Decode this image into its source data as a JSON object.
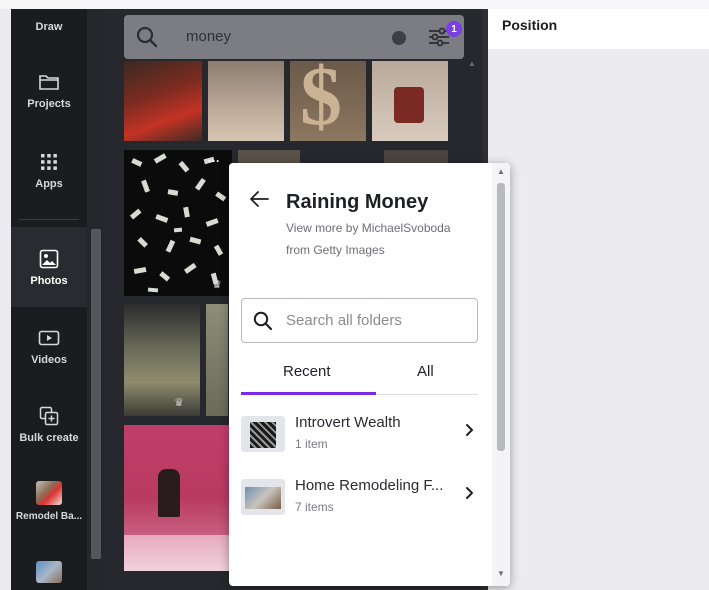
{
  "sidebar": {
    "items": [
      {
        "label": "Draw",
        "icon": "draw-icon"
      },
      {
        "label": "Projects",
        "icon": "folder-icon"
      },
      {
        "label": "Apps",
        "icon": "apps-grid-icon"
      },
      {
        "label": "Photos",
        "icon": "photos-icon",
        "active": true
      },
      {
        "label": "Videos",
        "icon": "video-play-icon"
      },
      {
        "label": "Bulk create",
        "icon": "bulk-create-icon"
      },
      {
        "label": "Remodel Ba...",
        "icon": "remodel-app-thumbnail"
      },
      {
        "label": "",
        "icon": "app-thumbnail"
      }
    ]
  },
  "search": {
    "query": "money",
    "filter_badge": "1"
  },
  "right_panel": {
    "title": "Position"
  },
  "popup": {
    "title": "Raining Money",
    "subtitle": "View more by MichaelSvoboda from Getty Images",
    "search_placeholder": "Search all folders",
    "tabs": [
      {
        "label": "Recent",
        "active": true
      },
      {
        "label": "All",
        "active": false
      }
    ],
    "folders": [
      {
        "name": "Introvert Wealth",
        "count": "1 item"
      },
      {
        "name": "Home Remodeling F...",
        "count": "7 items"
      }
    ]
  },
  "colors": {
    "accent": "#7d2ae8",
    "sidebar_bg": "#1b1c20",
    "panel_bg": "#27282d",
    "badge": "#7b3fe4"
  }
}
